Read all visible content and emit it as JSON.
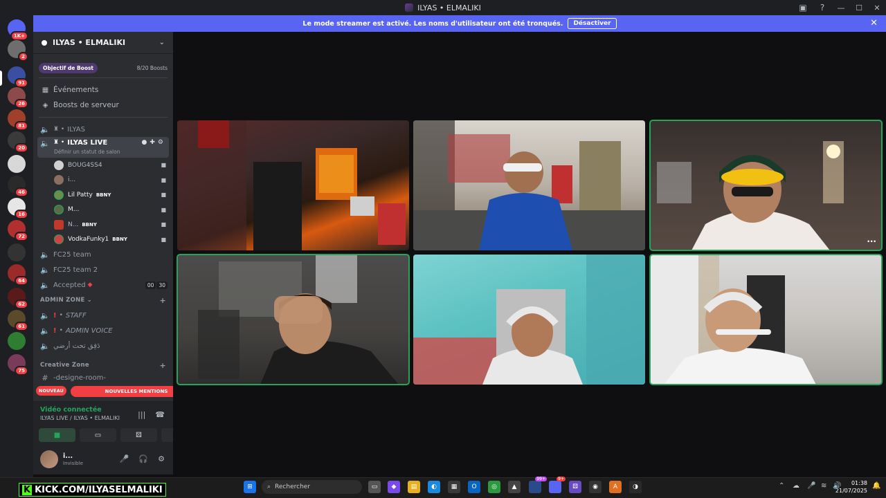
{
  "window": {
    "title": "ILYAS • ELMALIKI"
  },
  "banner": {
    "text": "Le mode streamer est activé. Les noms d'utilisateur ont été tronqués.",
    "button": "Désactiver"
  },
  "rail": {
    "badges": [
      "1K+",
      "2",
      "91",
      "26",
      "81",
      "20",
      "",
      "46",
      "16",
      "72",
      "",
      "64",
      "62",
      "61",
      "",
      "75"
    ]
  },
  "server": {
    "name": "ILYAS • ELMALIKI",
    "boost_goal": "Objectif de Boost",
    "boost_count": "8/20 Boosts"
  },
  "nav": {
    "events": "Événements",
    "boosts": "Boosts de serveur"
  },
  "channels": {
    "ilyas": "ILYAS",
    "ilyas_live": "ILYAS LIVE",
    "ilyas_live_status": "Définir un statut de salon",
    "fc25": "FC25 team",
    "fc25_2": "FC25 team 2",
    "accepted": "Accepted",
    "accepted_counts": [
      "00",
      "30"
    ],
    "admin_zone": "ADMIN ZONE",
    "staff": "STAFF",
    "admin_voice": "ADMIN VOICE",
    "arabic": "دَفِق تحت أرضي",
    "creative_zone": "Creative Zone",
    "designe_room": "-designe-room-"
  },
  "members": [
    {
      "name": "BOUG4SS4",
      "badge": ""
    },
    {
      "name": "i...",
      "badge": ""
    },
    {
      "name": "Lil Patty",
      "badge": "BBNY"
    },
    {
      "name": "M...",
      "badge": ""
    },
    {
      "name": "N...",
      "badge": "BBNY"
    },
    {
      "name": "VodkaFunky1",
      "badge": "BBNY"
    }
  ],
  "mentions": {
    "new": "NOUVEAU",
    "label": "NOUVELLES MENTIONS"
  },
  "voice": {
    "status": "Vidéo connectée",
    "channel": "ILYAS LIVE / ILYAS • ELMALIKI"
  },
  "user": {
    "name": "i...",
    "status": "Invisible"
  },
  "stream_overlay": {
    "text": "KICK.COM/ILYASELMALIKI"
  },
  "taskbar": {
    "search_placeholder": "Rechercher",
    "badge_a": "99+",
    "badge_b": "9+",
    "time": "01:38",
    "date": "21/07/2025"
  },
  "colors": {
    "accent": "#5865f2",
    "speaking": "#23a55a",
    "danger": "#f23f43",
    "kick": "#53fc18"
  }
}
